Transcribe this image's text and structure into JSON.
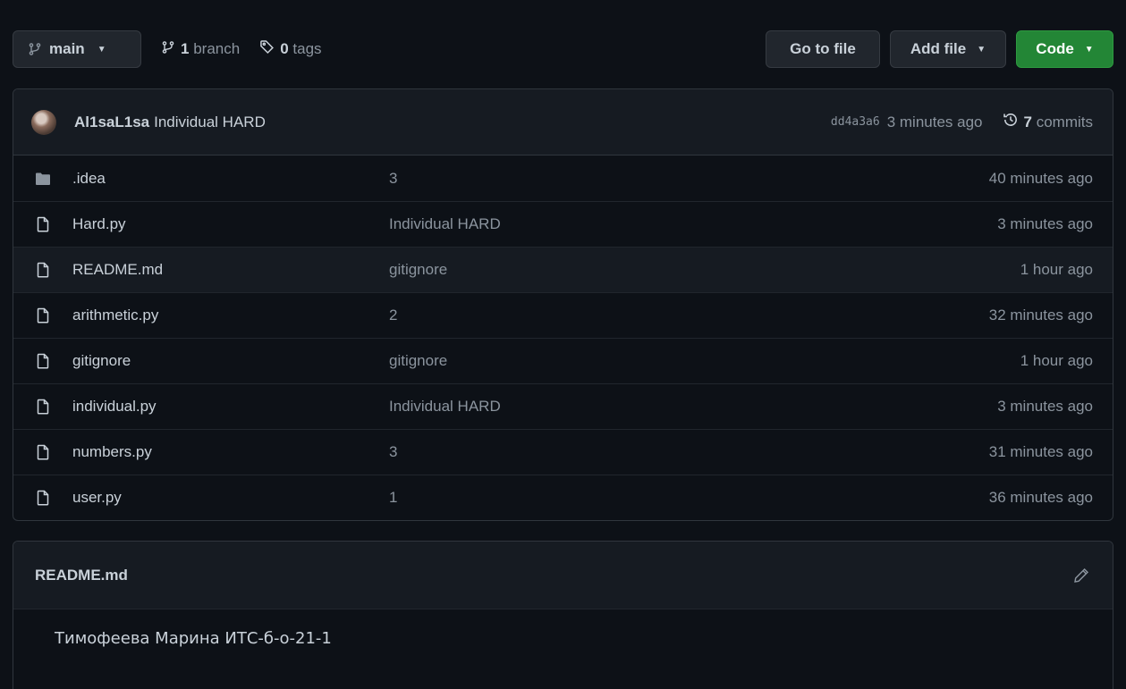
{
  "toolbar": {
    "branch_label": "main",
    "branch_count": "1",
    "branch_word": "branch",
    "tag_count": "0",
    "tag_word": "tags",
    "go_to_file": "Go to file",
    "add_file": "Add file",
    "code": "Code",
    "code_color": "#238636"
  },
  "commit": {
    "author": "Al1saL1sa",
    "message": "Individual HARD",
    "sha": "dd4a3a6",
    "time": "3 minutes ago",
    "commits_count": "7",
    "commits_word": "commits"
  },
  "files": [
    {
      "icon": "folder-icon",
      "name": ".idea",
      "commit": "3",
      "age": "40 minutes ago"
    },
    {
      "icon": "file-icon",
      "name": "Hard.py",
      "commit": "Individual HARD",
      "age": "3 minutes ago"
    },
    {
      "icon": "file-icon",
      "name": "README.md",
      "commit": "gitignore",
      "age": "1 hour ago"
    },
    {
      "icon": "file-icon",
      "name": "arithmetic.py",
      "commit": "2",
      "age": "32 minutes ago"
    },
    {
      "icon": "file-icon",
      "name": "gitignore",
      "commit": "gitignore",
      "age": "1 hour ago"
    },
    {
      "icon": "file-icon",
      "name": "individual.py",
      "commit": "Individual HARD",
      "age": "3 minutes ago"
    },
    {
      "icon": "file-icon",
      "name": "numbers.py",
      "commit": "3",
      "age": "31 minutes ago"
    },
    {
      "icon": "file-icon",
      "name": "user.py",
      "commit": "1",
      "age": "36 minutes ago"
    }
  ],
  "readme": {
    "title": "README.md",
    "content": "Тимофеева Марина ИТС-б-о-21-1"
  }
}
